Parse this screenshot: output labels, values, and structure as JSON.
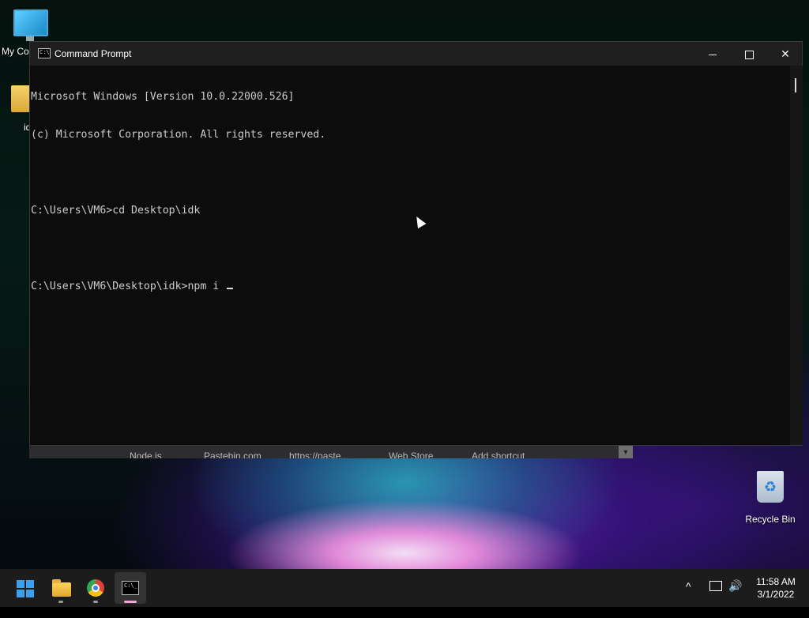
{
  "desktop": {
    "icons": [
      {
        "label": "My Co"
      },
      {
        "label": "id"
      },
      {
        "label": "Recycle Bin"
      }
    ]
  },
  "window": {
    "title": "Command Prompt",
    "buttons": {
      "close_glyph": "✕"
    }
  },
  "console": {
    "lines": [
      "Microsoft Windows [Version 10.0.22000.526]",
      "(c) Microsoft Corporation. All rights reserved.",
      "",
      "C:\\Users\\VM6>cd Desktop\\idk",
      "",
      "C:\\Users\\VM6\\Desktop\\idk>npm i"
    ]
  },
  "bookmarks": [
    "Node.js",
    "Pastebin.com",
    "https://paste...",
    "Web Store",
    "Add shortcut"
  ],
  "taskbar": {
    "apps": [
      "start-icon",
      "file-explorer-icon",
      "chrome-icon",
      "command-prompt-icon"
    ],
    "tray": {
      "chevron": "^",
      "volume": "🔊"
    },
    "time": "11:58 AM",
    "date": "3/1/2022"
  },
  "colors": {
    "accent": "#3aa0f2",
    "console_bg": "#0c0c0c",
    "console_fg": "#cccccc"
  }
}
